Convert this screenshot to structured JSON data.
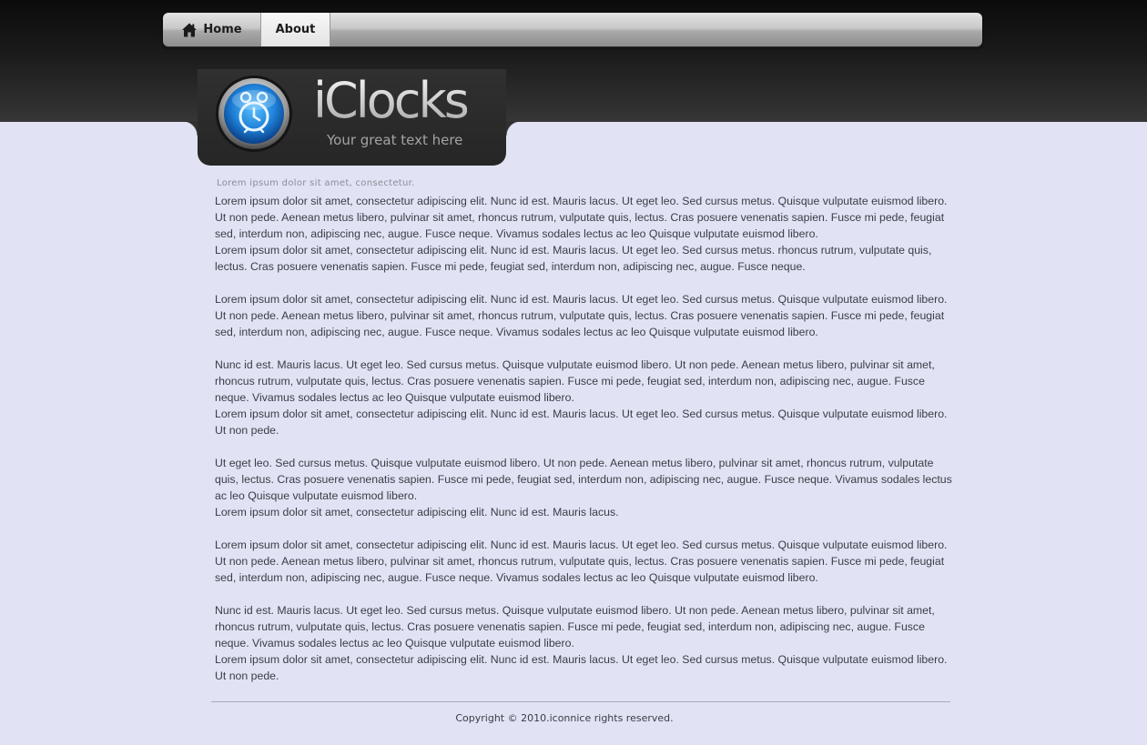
{
  "nav": {
    "home": {
      "label": "Home",
      "icon": "home-icon"
    },
    "about": {
      "label": "About"
    }
  },
  "logo": {
    "title": "iClocks",
    "tagline": "Your great text here",
    "icon": "alarm-clock-icon",
    "accent": "#2f8fe0"
  },
  "subtitle": "Lorem ipsum dolor sit amet, consectetur.",
  "content": {
    "blocks": [
      [
        "Lorem ipsum dolor sit amet, consectetur adipiscing elit. Nunc id est. Mauris lacus. Ut eget leo. Sed cursus metus. Quisque vulputate euismod libero. Ut non pede. Aenean metus libero, pulvinar sit amet, rhoncus rutrum, vulputate quis, lectus. Cras posuere venenatis sapien. Fusce mi pede, feugiat sed, interdum non, adipiscing nec, augue. Fusce neque. Vivamus sodales lectus ac leo Quisque vulputate euismod libero.",
        "Lorem ipsum dolor sit amet, consectetur adipiscing elit. Nunc id est. Mauris lacus. Ut eget leo. Sed cursus metus. rhoncus rutrum, vulputate quis, lectus. Cras posuere venenatis sapien. Fusce mi pede, feugiat sed, interdum non, adipiscing nec, augue. Fusce neque."
      ],
      [
        "Lorem ipsum dolor sit amet, consectetur adipiscing elit. Nunc id est. Mauris lacus. Ut eget leo. Sed cursus metus. Quisque vulputate euismod libero. Ut non pede. Aenean metus libero, pulvinar sit amet, rhoncus rutrum, vulputate quis, lectus. Cras posuere venenatis sapien. Fusce mi pede, feugiat sed, interdum non, adipiscing nec, augue. Fusce neque. Vivamus sodales lectus ac leo Quisque vulputate euismod libero."
      ],
      [
        "Nunc id est. Mauris lacus. Ut eget leo. Sed cursus metus. Quisque vulputate euismod libero. Ut non pede. Aenean metus libero, pulvinar sit amet, rhoncus rutrum, vulputate quis, lectus. Cras posuere venenatis sapien. Fusce mi pede, feugiat sed, interdum non, adipiscing nec, augue. Fusce neque. Vivamus sodales lectus ac leo Quisque vulputate euismod libero.",
        "Lorem ipsum dolor sit amet, consectetur adipiscing elit. Nunc id est. Mauris lacus. Ut eget leo. Sed cursus metus. Quisque vulputate euismod libero. Ut non pede."
      ],
      [
        "Ut eget leo. Sed cursus metus. Quisque vulputate euismod libero. Ut non pede. Aenean metus libero, pulvinar sit amet, rhoncus rutrum, vulputate quis, lectus. Cras posuere venenatis sapien. Fusce mi pede, feugiat sed, interdum non, adipiscing nec, augue. Fusce neque. Vivamus sodales lectus ac leo Quisque vulputate euismod libero.",
        "Lorem ipsum dolor sit amet, consectetur adipiscing elit. Nunc id est. Mauris lacus."
      ],
      [
        "Lorem ipsum dolor sit amet, consectetur adipiscing elit. Nunc id est. Mauris lacus. Ut eget leo. Sed cursus metus. Quisque vulputate euismod libero. Ut non pede. Aenean metus libero, pulvinar sit amet, rhoncus rutrum, vulputate quis, lectus. Cras posuere venenatis sapien. Fusce mi pede, feugiat sed, interdum non, adipiscing nec, augue. Fusce neque. Vivamus sodales lectus ac leo Quisque vulputate euismod libero."
      ],
      [
        "Nunc id est. Mauris lacus. Ut eget leo. Sed cursus metus. Quisque vulputate euismod libero. Ut non pede. Aenean metus libero, pulvinar sit amet, rhoncus rutrum, vulputate quis, lectus. Cras posuere venenatis sapien. Fusce mi pede, feugiat sed, interdum non, adipiscing nec, augue. Fusce neque. Vivamus sodales lectus ac leo Quisque vulputate euismod libero.",
        "Lorem ipsum dolor sit amet, consectetur adipiscing elit. Nunc id est. Mauris lacus. Ut eget leo. Sed cursus metus. Quisque vulputate euismod libero. Ut non pede."
      ]
    ]
  },
  "footer": {
    "copyright": "Copyright © 2010.iconnice rights reserved."
  }
}
